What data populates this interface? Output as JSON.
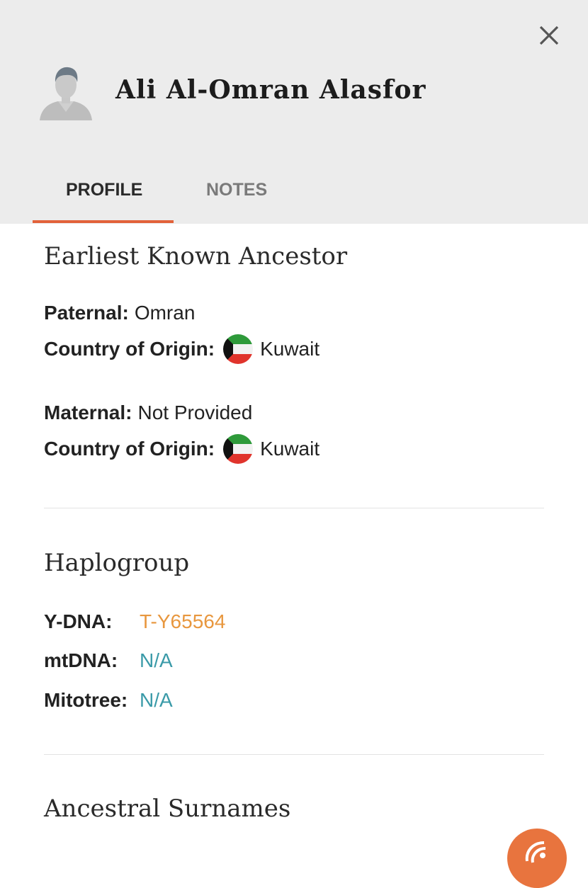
{
  "profile": {
    "name": "Ali Al-Omran Alasfor"
  },
  "tabs": [
    {
      "label": "PROFILE",
      "active": true
    },
    {
      "label": "NOTES",
      "active": false
    }
  ],
  "ancestor": {
    "title": "Earliest Known Ancestor",
    "paternal_label": "Paternal:",
    "paternal_value": "Omran",
    "paternal_country_label": "Country of Origin:",
    "paternal_country": "Kuwait",
    "maternal_label": "Maternal:",
    "maternal_value": "Not Provided",
    "maternal_country_label": "Country of Origin:",
    "maternal_country": "Kuwait"
  },
  "haplogroup": {
    "title": "Haplogroup",
    "ydna_label": "Y-DNA:",
    "ydna_value": "T-Y65564",
    "mtdna_label": "mtDNA:",
    "mtdna_value": "N/A",
    "mitotree_label": "Mitotree:",
    "mitotree_value": "N/A"
  },
  "surnames": {
    "title": "Ancestral Surnames"
  },
  "colors": {
    "accent": "#e2623a",
    "ydna": "#e8973e",
    "link": "#3a9aa8",
    "header_bg": "#ececec"
  },
  "icons": {
    "close": "close-icon",
    "avatar": "avatar-icon",
    "flag": "kuwait-flag-icon",
    "fab": "chat-icon"
  }
}
